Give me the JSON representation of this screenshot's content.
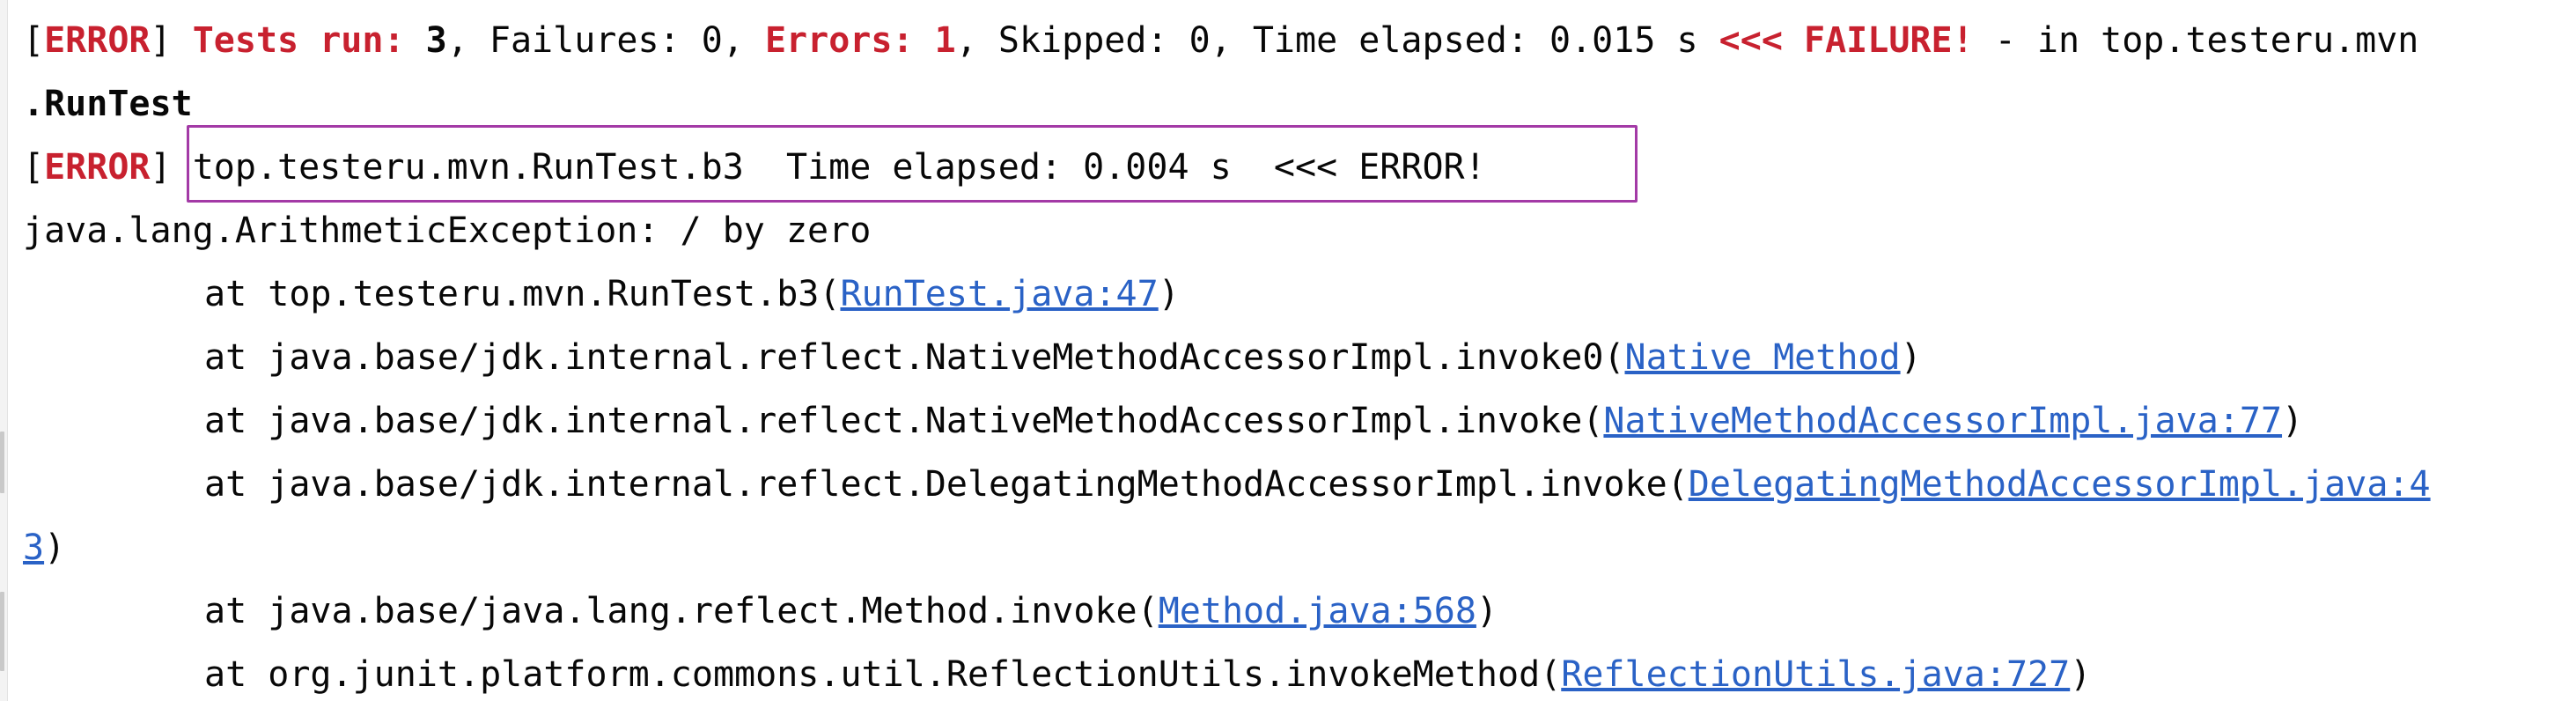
{
  "console": {
    "line1": {
      "bracket_open": "[",
      "tag": "ERROR",
      "bracket_close": "]",
      "tests_run_label": "Tests run:",
      "tests_run_value": "3",
      "failures": ", Failures: 0, ",
      "errors_label": "Errors: 1",
      "skipped": ", Skipped: 0, Time elapsed: 0.015 s ",
      "failure_marker": "<<< FAILURE!",
      "tail": " - in top.testeru.mvn"
    },
    "line2": {
      "text": ".RunTest"
    },
    "line3": {
      "bracket_open": "[",
      "tag": "ERROR",
      "bracket_close": "]",
      "text": " top.testeru.mvn.RunTest.b3  Time elapsed: 0.004 s  <<< ERROR!"
    },
    "line4": {
      "text": "java.lang.ArithmeticException: / by zero"
    },
    "stack": [
      {
        "prefix": "at top.testeru.mvn.RunTest.b3(",
        "link": "RunTest.java:47",
        "suffix": ")"
      },
      {
        "prefix": "at java.base/jdk.internal.reflect.NativeMethodAccessorImpl.invoke0(",
        "link": "Native Method",
        "suffix": ")"
      },
      {
        "prefix": "at java.base/jdk.internal.reflect.NativeMethodAccessorImpl.invoke(",
        "link": "NativeMethodAccessorImpl.java:77",
        "suffix": ")"
      },
      {
        "prefix": "at java.base/jdk.internal.reflect.DelegatingMethodAccessorImpl.invoke(",
        "link": "DelegatingMethodAccessorImpl.java:4",
        "suffix": ""
      },
      {
        "prefix": "",
        "link": "3",
        "suffix": ")"
      },
      {
        "prefix": "at java.base/java.lang.reflect.Method.invoke(",
        "link": "Method.java:568",
        "suffix": ")"
      },
      {
        "prefix": "at org.junit.platform.commons.util.ReflectionUtils.invokeMethod(",
        "link": "ReflectionUtils.java:727",
        "suffix": ")"
      }
    ]
  },
  "colors": {
    "error_red": "#c8212f",
    "link_blue": "#2a62c6",
    "highlight_purple": "#a33aa6"
  }
}
